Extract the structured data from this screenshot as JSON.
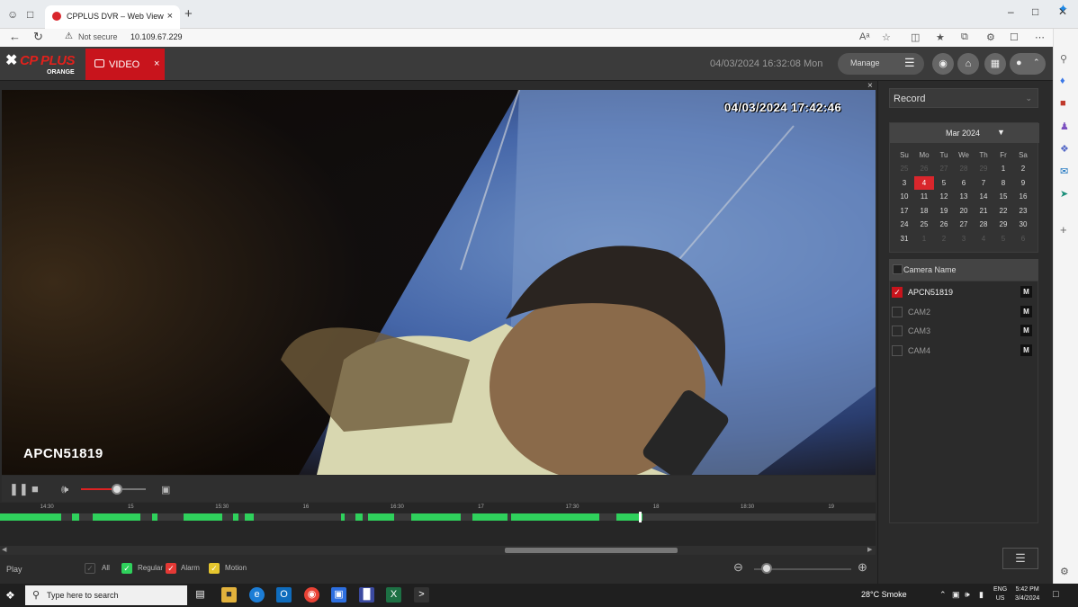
{
  "browser": {
    "tab_title": "CPPLUS DVR – Web View",
    "tab_close": "×",
    "new_tab": "+",
    "security_label": "Not secure",
    "url": "10.109.67.229",
    "window_controls": [
      "–",
      "□",
      "✕"
    ]
  },
  "app": {
    "logo_text": "CP PLUS",
    "logo_sub": "ORANGE",
    "video_tab_label": "VIDEO",
    "video_tab_close": "×",
    "datetime": "04/03/2024 16:32:08 Mon",
    "manage_label": "Manage"
  },
  "video": {
    "osd_timestamp": "04/03/2024 17:42:46",
    "osd_camera": "APCN51819",
    "close": "×"
  },
  "controls": {
    "volume_level": 0.55
  },
  "timeline": {
    "ticks": [
      "14:30",
      "15",
      "15:30",
      "16",
      "16:30",
      "17",
      "17:30",
      "18",
      "18:30",
      "19"
    ],
    "start_hour": 14.25,
    "end_hour": 19.25,
    "segments": [
      [
        14.25,
        14.6
      ],
      [
        14.66,
        14.7
      ],
      [
        14.78,
        15.05
      ],
      [
        15.12,
        15.15
      ],
      [
        15.3,
        15.52
      ],
      [
        15.58,
        15.61
      ],
      [
        15.65,
        15.7
      ],
      [
        16.2,
        16.22
      ],
      [
        16.28,
        16.32
      ],
      [
        16.35,
        16.5
      ],
      [
        16.6,
        16.88
      ],
      [
        16.95,
        17.15
      ],
      [
        17.17,
        17.67
      ],
      [
        17.77,
        17.92
      ]
    ],
    "cursor_hour": 17.9
  },
  "bottom": {
    "play_label": "Play",
    "filters": [
      {
        "label": "All",
        "checked": false,
        "color": "#555555"
      },
      {
        "label": "Regular",
        "checked": true,
        "color": "#2fd15c"
      },
      {
        "label": "Alarm",
        "checked": true,
        "color": "#e53935"
      },
      {
        "label": "Motion",
        "checked": true,
        "color": "#e6c62e"
      }
    ]
  },
  "right_panel": {
    "record_select": "Record",
    "calendar": {
      "month_label": "Mar 2024",
      "dow": [
        "Su",
        "Mo",
        "Tu",
        "We",
        "Th",
        "Fr",
        "Sa"
      ],
      "weeks": [
        [
          "25",
          "26",
          "27",
          "28",
          "29",
          "1",
          "2"
        ],
        [
          "3",
          "4",
          "5",
          "6",
          "7",
          "8",
          "9"
        ],
        [
          "10",
          "11",
          "12",
          "13",
          "14",
          "15",
          "16"
        ],
        [
          "17",
          "18",
          "19",
          "20",
          "21",
          "22",
          "23"
        ],
        [
          "24",
          "25",
          "26",
          "27",
          "28",
          "29",
          "30"
        ],
        [
          "31",
          "1",
          "2",
          "3",
          "4",
          "5",
          "6"
        ]
      ],
      "selected": "4",
      "accent": "#d9262c"
    },
    "camera_header": "Camera Name",
    "cameras": [
      {
        "name": "APCN51819",
        "checked": true,
        "m": "M"
      },
      {
        "name": "CAM2",
        "checked": false,
        "m": "M"
      },
      {
        "name": "CAM3",
        "checked": false,
        "m": "M"
      },
      {
        "name": "CAM4",
        "checked": false,
        "m": "M"
      }
    ]
  },
  "taskbar": {
    "search_placeholder": "Type here to search",
    "weather": "28°C  Smoke",
    "lang_top": "ENG",
    "lang_bottom": "US",
    "time": "5:42 PM",
    "date": "3/4/2024"
  }
}
